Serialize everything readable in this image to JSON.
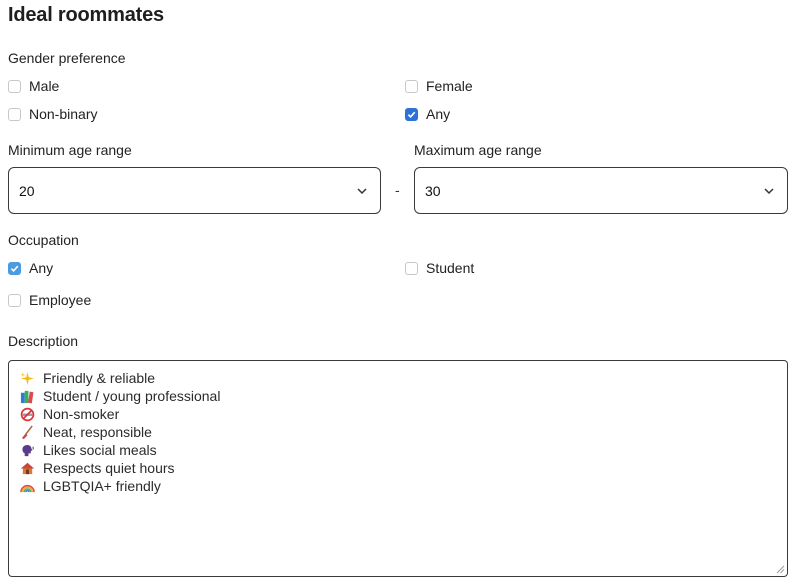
{
  "title": "Ideal roommates",
  "gender": {
    "label": "Gender preference",
    "options": [
      {
        "label": "Male",
        "checked": false
      },
      {
        "label": "Female",
        "checked": false
      },
      {
        "label": "Non-binary",
        "checked": false
      },
      {
        "label": "Any",
        "checked": true
      }
    ]
  },
  "age": {
    "min_label": "Minimum age range",
    "max_label": "Maximum age range",
    "min_value": "20",
    "max_value": "30",
    "separator": "-"
  },
  "occupation": {
    "label": "Occupation",
    "options": [
      {
        "label": "Any",
        "checked": true
      },
      {
        "label": "Student",
        "checked": false
      },
      {
        "label": "Employee",
        "checked": false
      }
    ]
  },
  "description": {
    "label": "Description",
    "lines": [
      {
        "icon": "sparkles-icon",
        "text": "Friendly & reliable"
      },
      {
        "icon": "books-icon",
        "text": "Student / young professional"
      },
      {
        "icon": "no-smoking-icon",
        "text": "Non-smoker"
      },
      {
        "icon": "broom-icon",
        "text": "Neat, responsible"
      },
      {
        "icon": "speaking-head-icon",
        "text": "Likes social meals"
      },
      {
        "icon": "house-icon",
        "text": "Respects quiet hours"
      },
      {
        "icon": "rainbow-icon",
        "text": "LGBTQIA+ friendly"
      }
    ]
  },
  "colors": {
    "checkbox_checked": "#2f72d6",
    "border": "#3a3a3a"
  }
}
